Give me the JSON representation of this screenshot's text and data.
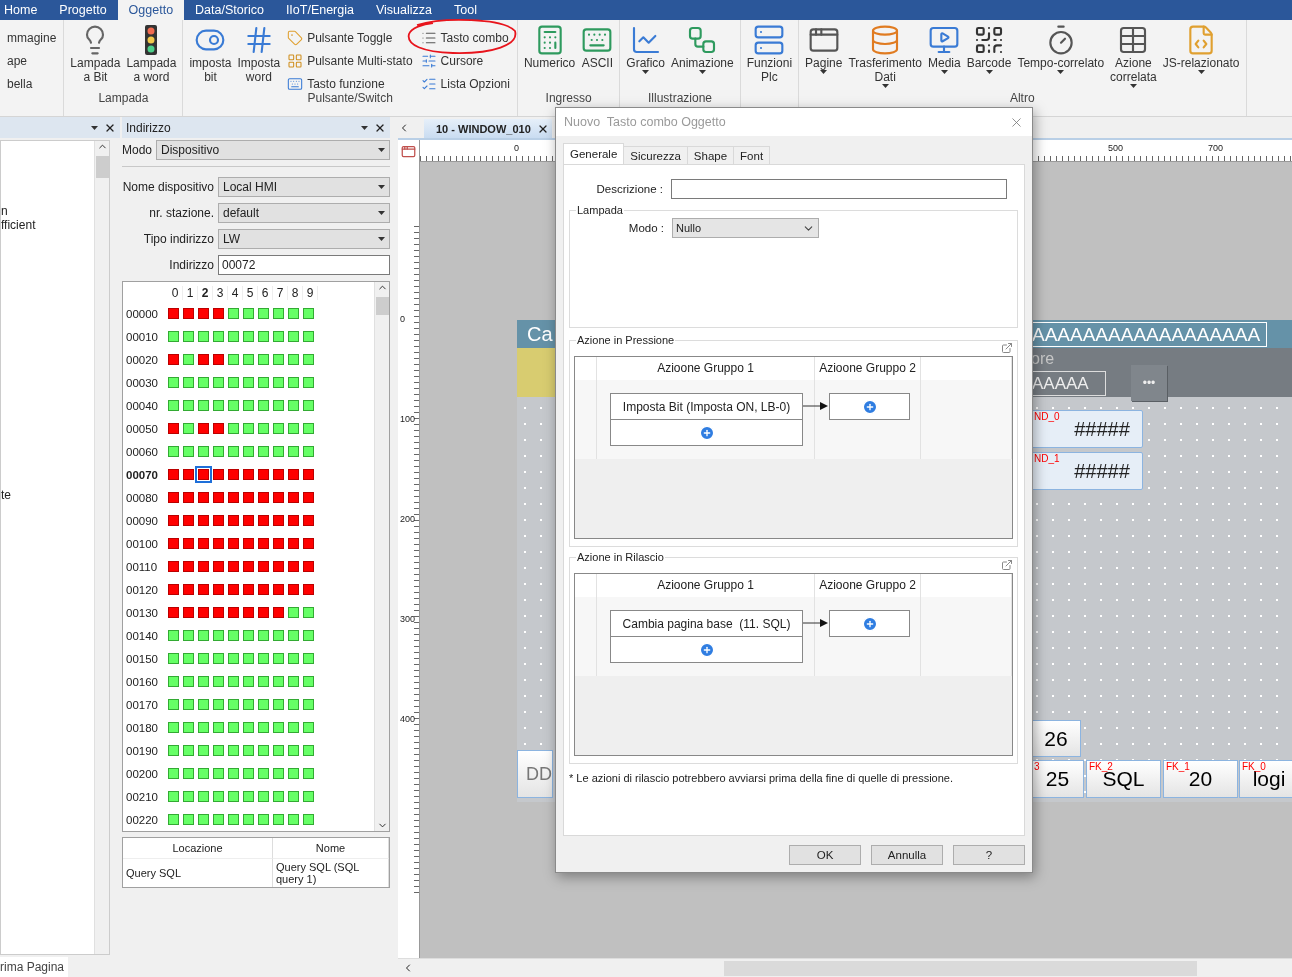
{
  "menu_tabs": [
    {
      "label": "Home",
      "selected": false
    },
    {
      "label": "Progetto",
      "selected": false
    },
    {
      "label": "Oggetto",
      "selected": true
    },
    {
      "label": "Data/Storico",
      "selected": false
    },
    {
      "label": "IIoT/Energia",
      "selected": false
    },
    {
      "label": "Visualizza",
      "selected": false
    },
    {
      "label": "Tool",
      "selected": false
    }
  ],
  "ribbon_groups": [
    {
      "items": [
        {
          "kind": "column",
          "items": [
            {
              "label": "mmagine",
              "circled": false
            },
            {
              "label": "ape",
              "circled": false
            },
            {
              "label": "bella",
              "circled": false
            }
          ]
        }
      ]
    },
    {
      "label": "Lampada",
      "items": [
        {
          "kind": "large",
          "label": "Lampada\na Bit",
          "dropdown": false
        },
        {
          "kind": "large",
          "label": "Lampada\na word",
          "dropdown": false
        }
      ]
    },
    {
      "label": "Pulsante/Switch",
      "items": [
        {
          "kind": "large",
          "label": "imposta\nbit",
          "dropdown": false
        },
        {
          "kind": "large",
          "label": "Imposta\nword",
          "dropdown": false
        },
        {
          "kind": "column",
          "items": [
            {
              "label": "Pulsante Toggle",
              "circled": false
            },
            {
              "label": "Pulsante Multi-stato",
              "circled": false
            },
            {
              "label": "Tasto funzione",
              "circled": false
            }
          ]
        },
        {
          "kind": "column",
          "items": [
            {
              "label": "Tasto combo",
              "circled": true
            },
            {
              "label": "Cursore",
              "circled": false
            },
            {
              "label": "Lista Opzioni",
              "circled": false
            }
          ]
        }
      ]
    },
    {
      "label": "Ingresso",
      "items": [
        {
          "kind": "large",
          "label": "Numerico",
          "dropdown": false
        },
        {
          "kind": "large",
          "label": "ASCII",
          "dropdown": false
        }
      ]
    },
    {
      "label": "Illustrazione",
      "items": [
        {
          "kind": "large",
          "label": "Grafico",
          "dropdown": true
        },
        {
          "kind": "large",
          "label": "Animazione",
          "dropdown": true
        }
      ]
    },
    {
      "items": [
        {
          "kind": "large",
          "label": "Funzioni\nPlc",
          "dropdown": false
        }
      ]
    },
    {
      "label": "Altro",
      "items": [
        {
          "kind": "large",
          "label": "Pagine",
          "dropdown": true
        },
        {
          "kind": "large",
          "label": "Trasferimento\nDati",
          "dropdown": true
        },
        {
          "kind": "large",
          "label": "Media",
          "dropdown": true
        },
        {
          "kind": "large",
          "label": "Barcode",
          "dropdown": true
        },
        {
          "kind": "large",
          "label": "Tempo-correlato",
          "dropdown": true
        },
        {
          "kind": "large",
          "label": "Azione\ncorrelata",
          "dropdown": true
        },
        {
          "kind": "large",
          "label": "JS-relazionato",
          "dropdown": true
        }
      ]
    }
  ],
  "left_pane": {
    "items": [
      {
        "label": "n"
      },
      {
        "label": "fficient"
      },
      {
        "label": "te"
      }
    ],
    "bottom_tab": "rima Pagina"
  },
  "address_panel": {
    "title": "Indirizzo",
    "mode": {
      "label": "Modo",
      "value": "Dispositivo"
    },
    "fields": [
      {
        "label": "Nome dispositivo",
        "value": "Local HMI",
        "kind": "select"
      },
      {
        "label": "nr. stazione.",
        "value": "default",
        "kind": "select"
      },
      {
        "label": "Tipo indirizzo",
        "value": "LW",
        "kind": "select"
      },
      {
        "label": "Indirizzo",
        "value": "00072",
        "kind": "input"
      }
    ],
    "grid": {
      "columns": [
        {
          "label": "0",
          "selected": false
        },
        {
          "label": "1",
          "selected": false
        },
        {
          "label": "2",
          "selected": true
        },
        {
          "label": "3",
          "selected": false
        },
        {
          "label": "4",
          "selected": false
        },
        {
          "label": "5",
          "selected": false
        },
        {
          "label": "6",
          "selected": false
        },
        {
          "label": "7",
          "selected": false
        },
        {
          "label": "8",
          "selected": false
        },
        {
          "label": "9",
          "selected": false
        }
      ],
      "rows": [
        {
          "address": "00000",
          "selected": false,
          "bits": [
            true,
            true,
            true,
            true,
            false,
            false,
            false,
            false,
            false,
            false
          ]
        },
        {
          "address": "00010",
          "selected": false,
          "bits": [
            false,
            false,
            false,
            false,
            false,
            false,
            false,
            false,
            false,
            false
          ]
        },
        {
          "address": "00020",
          "selected": false,
          "bits": [
            true,
            false,
            true,
            true,
            false,
            false,
            false,
            false,
            false,
            false
          ]
        },
        {
          "address": "00030",
          "selected": false,
          "bits": [
            false,
            false,
            false,
            false,
            false,
            false,
            false,
            false,
            false,
            false
          ]
        },
        {
          "address": "00040",
          "selected": false,
          "bits": [
            false,
            false,
            false,
            false,
            false,
            false,
            false,
            false,
            false,
            false
          ]
        },
        {
          "address": "00050",
          "selected": false,
          "bits": [
            true,
            false,
            true,
            true,
            false,
            false,
            false,
            false,
            false,
            false
          ]
        },
        {
          "address": "00060",
          "selected": false,
          "bits": [
            false,
            false,
            false,
            false,
            false,
            false,
            false,
            false,
            false,
            false
          ]
        },
        {
          "address": "00070",
          "selected": true,
          "bits": [
            true,
            true,
            true,
            true,
            true,
            true,
            true,
            true,
            true,
            true
          ]
        },
        {
          "address": "00080",
          "selected": false,
          "bits": [
            true,
            true,
            true,
            true,
            true,
            true,
            true,
            true,
            true,
            true
          ]
        },
        {
          "address": "00090",
          "selected": false,
          "bits": [
            true,
            true,
            true,
            true,
            true,
            true,
            true,
            true,
            true,
            true
          ]
        },
        {
          "address": "00100",
          "selected": false,
          "bits": [
            true,
            true,
            true,
            true,
            true,
            true,
            true,
            true,
            true,
            true
          ]
        },
        {
          "address": "00110",
          "selected": false,
          "bits": [
            true,
            true,
            true,
            true,
            true,
            true,
            true,
            true,
            true,
            true
          ]
        },
        {
          "address": "00120",
          "selected": false,
          "bits": [
            true,
            true,
            true,
            true,
            true,
            true,
            true,
            true,
            true,
            true
          ]
        },
        {
          "address": "00130",
          "selected": false,
          "bits": [
            true,
            true,
            true,
            true,
            true,
            true,
            true,
            true,
            false,
            false
          ]
        },
        {
          "address": "00140",
          "selected": false,
          "bits": [
            false,
            false,
            false,
            false,
            false,
            false,
            false,
            false,
            false,
            false
          ]
        },
        {
          "address": "00150",
          "selected": false,
          "bits": [
            false,
            false,
            false,
            false,
            false,
            false,
            false,
            false,
            false,
            false
          ]
        },
        {
          "address": "00160",
          "selected": false,
          "bits": [
            false,
            false,
            false,
            false,
            false,
            false,
            false,
            false,
            false,
            false
          ]
        },
        {
          "address": "00170",
          "selected": false,
          "bits": [
            false,
            false,
            false,
            false,
            false,
            false,
            false,
            false,
            false,
            false
          ]
        },
        {
          "address": "00180",
          "selected": false,
          "bits": [
            false,
            false,
            false,
            false,
            false,
            false,
            false,
            false,
            false,
            false
          ]
        },
        {
          "address": "00190",
          "selected": false,
          "bits": [
            false,
            false,
            false,
            false,
            false,
            false,
            false,
            false,
            false,
            false
          ]
        },
        {
          "address": "00200",
          "selected": false,
          "bits": [
            false,
            false,
            false,
            false,
            false,
            false,
            false,
            false,
            false,
            false
          ]
        },
        {
          "address": "00210",
          "selected": false,
          "bits": [
            false,
            false,
            false,
            false,
            false,
            false,
            false,
            false,
            false,
            false
          ]
        },
        {
          "address": "00220",
          "selected": false,
          "bits": [
            false,
            false,
            false,
            false,
            false,
            false,
            false,
            false,
            false,
            false
          ]
        }
      ]
    },
    "table": {
      "columns": [
        "Locazione",
        "Nome"
      ],
      "rows": [
        [
          "Query SQL",
          "Query SQL (SQL query 1)"
        ]
      ]
    }
  },
  "document_tab": {
    "label": "10 - WINDOW_010"
  },
  "ruler": {
    "horizontal": [
      "0",
      "500",
      "700"
    ],
    "vertical": [
      "0",
      "100",
      "200",
      "300",
      "400"
    ]
  },
  "hmi_screen": {
    "objects": [
      {
        "kind": "title",
        "text": "Ca"
      },
      {
        "kind": "title_field",
        "text": "AAAAAAAAAAAAAAAAAA"
      },
      {
        "kind": "label",
        "text": "ore"
      },
      {
        "kind": "field",
        "text": "AAAAA"
      },
      {
        "kind": "more_button",
        "text": "•••"
      },
      {
        "kind": "numeric",
        "tag": "ND_0",
        "text": "#####"
      },
      {
        "kind": "numeric",
        "tag": "ND_1",
        "text": "#####"
      },
      {
        "kind": "key",
        "text": "DD"
      },
      {
        "kind": "key",
        "text": "26"
      },
      {
        "kind": "key",
        "tag": "3",
        "text": "25"
      },
      {
        "kind": "key",
        "tag": "FK_2",
        "text": "SQL"
      },
      {
        "kind": "key",
        "tag": "FK_1",
        "text": "20"
      },
      {
        "kind": "key",
        "tag": "FK_0",
        "text": "logi"
      }
    ]
  },
  "dialog": {
    "title": "Nuovo  Tasto combo Oggetto",
    "tabs": [
      {
        "label": "Generale",
        "selected": true
      },
      {
        "label": "Sicurezza",
        "selected": false
      },
      {
        "label": "Shape",
        "selected": false
      },
      {
        "label": "Font",
        "selected": false
      }
    ],
    "description_label": "Descrizione :",
    "lamp": {
      "title": "Lampada",
      "mode_label": "Modo :",
      "mode_value": "Nullo"
    },
    "action_groups": [
      {
        "title": "Azione in Pressione",
        "columns": [
          "Azioone Gruppo 1",
          "Azioone Gruppo 2"
        ],
        "actions": [
          "Imposta Bit (Imposta ON, LB-0)"
        ]
      },
      {
        "title": "Azione in Rilascio",
        "columns": [
          "Azioone Gruppo 1",
          "Azioone Gruppo 2"
        ],
        "actions": [
          "Cambia pagina base  (11. SQL)"
        ]
      }
    ],
    "note": "* Le azioni di rilascio potrebbero avviarsi prima della fine di quelle di pressione.",
    "buttons": [
      "OK",
      "Annulla",
      "?"
    ]
  }
}
